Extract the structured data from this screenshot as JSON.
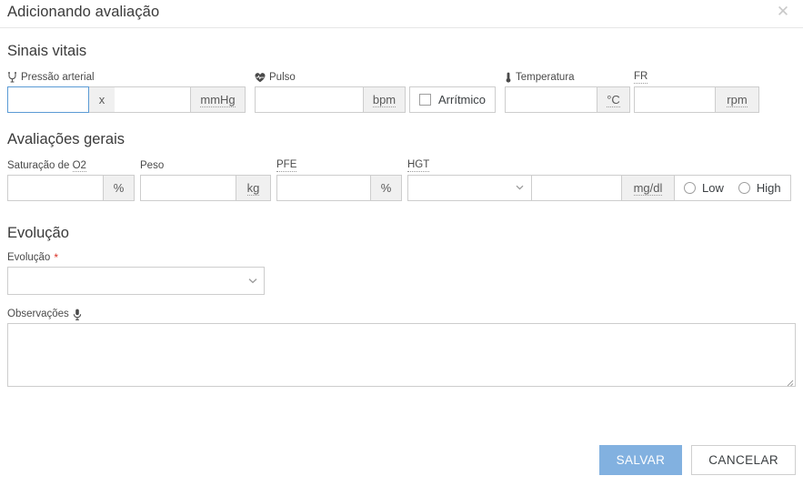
{
  "dialog": {
    "title": "Adicionando avaliação",
    "close_icon": "close-icon"
  },
  "sections": {
    "vitals": {
      "title": "Sinais vitais",
      "blood_pressure": {
        "label": "Pressão arterial",
        "icon": "blood-pressure-icon",
        "systolic_value": "",
        "separator": "x",
        "diastolic_value": "",
        "unit": "mmHg"
      },
      "pulse": {
        "label": "Pulso",
        "icon": "heart-pulse-icon",
        "value": "",
        "unit": "bpm",
        "arrhythmic_label": "Arrítmico",
        "arrhythmic_checked": false
      },
      "temperature": {
        "label": "Temperatura",
        "icon": "thermometer-icon",
        "value": "",
        "unit": "°C"
      },
      "respiratory_rate": {
        "label": "FR",
        "value": "",
        "unit": "rpm"
      }
    },
    "general": {
      "title": "Avaliações gerais",
      "saturation": {
        "label": "Saturação de O2",
        "value": "",
        "unit": "%"
      },
      "weight": {
        "label": "Peso",
        "value": "",
        "unit": "kg"
      },
      "pfe": {
        "label": "PFE",
        "value": "",
        "unit": "%"
      },
      "hgt": {
        "label": "HGT",
        "select_value": "",
        "value": "",
        "unit": "mg/dl",
        "low_label": "Low",
        "high_label": "High",
        "low_selected": false,
        "high_selected": false
      }
    },
    "evolution": {
      "title": "Evolução",
      "select_label": "Evolução",
      "required_marker": "*",
      "select_value": "",
      "notes_label": "Observações",
      "notes_icon": "microphone-icon",
      "notes_value": ""
    }
  },
  "footer": {
    "save_label": "SALVAR",
    "cancel_label": "CANCELAR"
  },
  "colors": {
    "primary": "#82b1e0",
    "focus_border": "#5b9bd5",
    "required": "#d93025",
    "addon_bg": "#f0f0f0",
    "border": "#cdcdcd"
  }
}
